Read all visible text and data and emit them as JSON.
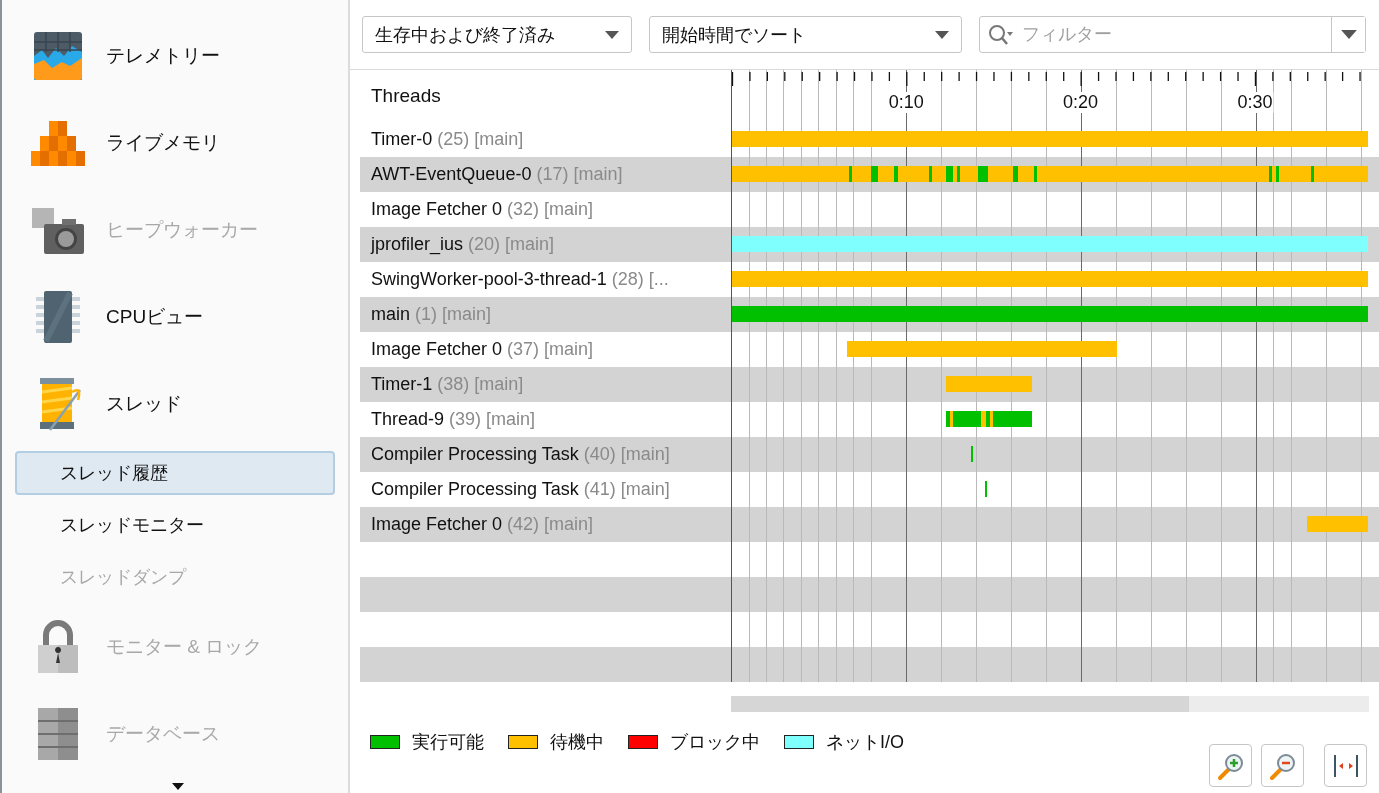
{
  "sidebar": {
    "items": [
      {
        "kind": "category",
        "label": "テレメトリー",
        "disabled": false
      },
      {
        "kind": "category",
        "label": "ライブメモリ",
        "disabled": false
      },
      {
        "kind": "category",
        "label": "ヒープウォーカー",
        "disabled": true
      },
      {
        "kind": "category",
        "label": "CPUビュー",
        "disabled": false
      },
      {
        "kind": "category",
        "label": "スレッド",
        "disabled": false
      },
      {
        "kind": "view",
        "label": "スレッド履歴",
        "selected": true,
        "disabled": false
      },
      {
        "kind": "view",
        "label": "スレッドモニター",
        "selected": false,
        "disabled": false
      },
      {
        "kind": "view",
        "label": "スレッドダンプ",
        "selected": false,
        "disabled": true
      },
      {
        "kind": "category",
        "label": "モニター & ロック",
        "disabled": true
      },
      {
        "kind": "category",
        "label": "データベース",
        "disabled": true
      }
    ]
  },
  "toolbar": {
    "thread_filter": "生存中および終了済み",
    "sort": "開始時間でソート",
    "filter_placeholder": "フィルター"
  },
  "table": {
    "header": "Threads",
    "time_labels": [
      "0:10",
      "0:20",
      "0:30"
    ],
    "threads": [
      {
        "name": "Timer-0",
        "id": "(25)",
        "group": "[main]"
      },
      {
        "name": "AWT-EventQueue-0",
        "id": "(17)",
        "group": "[main]"
      },
      {
        "name": "Image Fetcher 0",
        "id": "(32)",
        "group": "[main]"
      },
      {
        "name": "jprofiler_ius",
        "id": "(20)",
        "group": "[main]"
      },
      {
        "name": "SwingWorker-pool-3-thread-1",
        "id": "(28)",
        "group": "[..."
      },
      {
        "name": "main",
        "id": "(1)",
        "group": "[main]"
      },
      {
        "name": "Image Fetcher 0",
        "id": "(37)",
        "group": "[main]"
      },
      {
        "name": "Timer-1",
        "id": "(38)",
        "group": "[main]"
      },
      {
        "name": "Thread-9",
        "id": "(39)",
        "group": "[main]"
      },
      {
        "name": "Compiler Processing Task",
        "id": "(40)",
        "group": "[main]"
      },
      {
        "name": "Compiler Processing Task",
        "id": "(41)",
        "group": "[main]"
      },
      {
        "name": "Image Fetcher 0",
        "id": "(42)",
        "group": "[main]"
      }
    ]
  },
  "legend": [
    {
      "label": "実行可能",
      "color": "#00c000"
    },
    {
      "label": "待機中",
      "color": "#ffc000"
    },
    {
      "label": "ブロック中",
      "color": "#ff0000"
    },
    {
      "label": "ネットI/O",
      "color": "#80ffff"
    }
  ]
}
